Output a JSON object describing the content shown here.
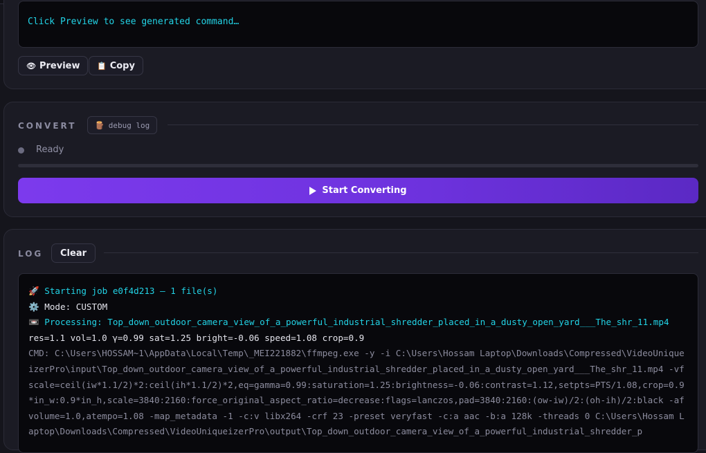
{
  "command": {
    "placeholder_text": "Click Preview to see generated command…",
    "preview_label": "Preview",
    "preview_icon": "eye-icon",
    "copy_label": "Copy",
    "copy_icon": "clipboard-icon"
  },
  "convert": {
    "section_label": "CONVERT",
    "debug_label": "debug log",
    "debug_icon": "log-icon",
    "status_text": "Ready",
    "progress_fraction": 0,
    "start_label": "Start Converting",
    "start_icon": "play-icon",
    "accent_color": "#7c3aed"
  },
  "log": {
    "section_label": "LOG",
    "clear_label": "Clear",
    "lines": [
      {
        "icon": "🚀",
        "text": "Starting job e0f4d213 — 1 file(s)",
        "color": "cyan"
      },
      {
        "icon": "⚙️",
        "text": "Mode: CUSTOM",
        "color": "white"
      },
      {
        "icon": "📼",
        "text": "Processing: Top_down_outdoor_camera_view_of_a_powerful_industrial_shredder_placed_in_a_dusty_open_yard___The_shr_11.mp4",
        "color": "cyan"
      },
      {
        "icon": "",
        "text": "res=1.1 vol=1.0 γ=0.99 sat=1.25 bright=-0.06 speed=1.08 crop=0.9",
        "color": "white"
      },
      {
        "icon": "",
        "text": "CMD: C:\\Users\\HOSSAM~1\\AppData\\Local\\Temp\\_MEI221882\\ffmpeg.exe -y -i C:\\Users\\Hossam Laptop\\Downloads\\Compressed\\VideoUniquеizerPro\\input\\Top_down_outdoor_camera_view_of_a_powerful_industrial_shredder_placed_in_a_dusty_open_yard___The_shr_11.mp4 -vf scale=ceil(iw*1.1/2)*2:ceil(ih*1.1/2)*2,eq=gamma=0.99:saturation=1.25:brightness=-0.06:contrast=1.12,setpts=PTS/1.08,crop=0.9*in_w:0.9*in_h,scale=3840:2160:force_original_aspect_ratio=decrease:flags=lanczos,pad=3840:2160:(ow-iw)/2:(oh-ih)/2:black -af volume=1.0,atempo=1.08 -map_metadata -1 -c:v libx264 -crf 23 -preset veryfast -c:a aac -b:a 128k -threads 0 C:\\Users\\Hossam Laptop\\Downloads\\Compressed\\VideoUniquеizerPro\\output\\Top_down_outdoor_camera_view_of_a_powerful_industrial_shredder_p",
        "color": "gray"
      }
    ]
  }
}
